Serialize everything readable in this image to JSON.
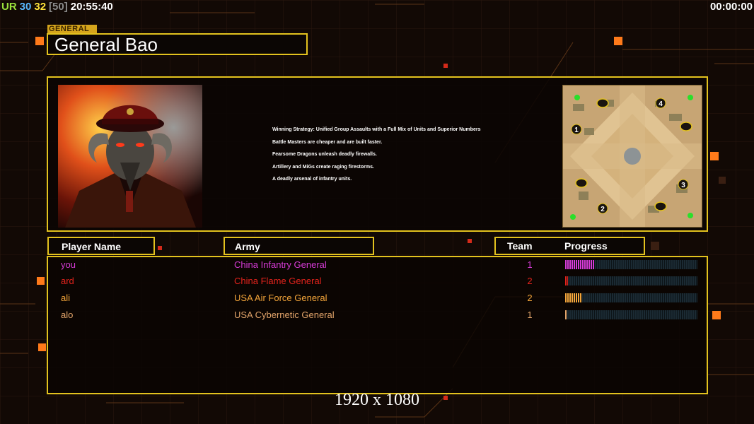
{
  "hud": {
    "left": {
      "ur": "UR",
      "val1": "30",
      "val2": "32",
      "val3": "[50]",
      "time": "20:55:40"
    },
    "right_timer": "00:00:00"
  },
  "general": {
    "tag": "GENERAL",
    "name": "General Bao"
  },
  "strategy": [
    "Winning Strategy: Unified Group Assaults with a Full Mix of Units and Superior Numbers",
    "Battle Masters are cheaper and are built faster.",
    "Fearsome Dragons unleash deadly firewalls.",
    "Artillery and MiGs create raging firestorms.",
    "A deadly arsenal of infantry units."
  ],
  "map": {
    "start_positions": [
      "1",
      "2",
      "3",
      "4"
    ]
  },
  "headers": {
    "player_name": "Player Name",
    "army": "Army",
    "team": "Team",
    "progress": "Progress"
  },
  "players": [
    {
      "name": "you",
      "army": "China Infantry General",
      "team": "1",
      "progress": 0.22,
      "color": "#d63bd6"
    },
    {
      "name": "ard",
      "army": "China Flame General",
      "team": "2",
      "progress": 0.02,
      "color": "#e3231c"
    },
    {
      "name": "ali",
      "army": "USA Air Force General",
      "team": "2",
      "progress": 0.13,
      "color": "#f4a53a"
    },
    {
      "name": "alo",
      "army": "USA Cybernetic General",
      "team": "1",
      "progress": 0.01,
      "color": "#e2a46a"
    }
  ],
  "resolution": "1920 x 1080",
  "colors": {
    "frame": "#e3c21e",
    "background": "#120905",
    "accent_orange": "#ff7a1a"
  }
}
